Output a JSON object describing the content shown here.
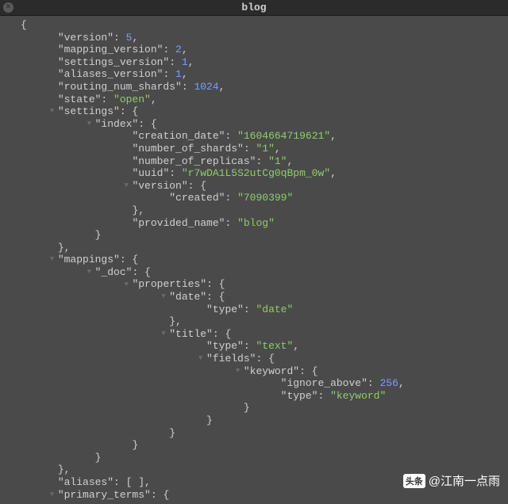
{
  "window": {
    "title": "blog"
  },
  "json_lines": [
    {
      "indent": 0,
      "toggle": "",
      "text": [
        {
          "t": "{",
          "c": "punct"
        }
      ]
    },
    {
      "indent": 2,
      "toggle": "",
      "text": [
        {
          "t": "\"version\"",
          "c": "key"
        },
        {
          "t": ": ",
          "c": "punct"
        },
        {
          "t": "5",
          "c": "num"
        },
        {
          "t": ",",
          "c": "punct"
        }
      ]
    },
    {
      "indent": 2,
      "toggle": "",
      "text": [
        {
          "t": "\"mapping_version\"",
          "c": "key"
        },
        {
          "t": ": ",
          "c": "punct"
        },
        {
          "t": "2",
          "c": "num"
        },
        {
          "t": ",",
          "c": "punct"
        }
      ]
    },
    {
      "indent": 2,
      "toggle": "",
      "text": [
        {
          "t": "\"settings_version\"",
          "c": "key"
        },
        {
          "t": ": ",
          "c": "punct"
        },
        {
          "t": "1",
          "c": "num"
        },
        {
          "t": ",",
          "c": "punct"
        }
      ]
    },
    {
      "indent": 2,
      "toggle": "",
      "text": [
        {
          "t": "\"aliases_version\"",
          "c": "key"
        },
        {
          "t": ": ",
          "c": "punct"
        },
        {
          "t": "1",
          "c": "num"
        },
        {
          "t": ",",
          "c": "punct"
        }
      ]
    },
    {
      "indent": 2,
      "toggle": "",
      "text": [
        {
          "t": "\"routing_num_shards\"",
          "c": "key"
        },
        {
          "t": ": ",
          "c": "punct"
        },
        {
          "t": "1024",
          "c": "num"
        },
        {
          "t": ",",
          "c": "punct"
        }
      ]
    },
    {
      "indent": 2,
      "toggle": "",
      "text": [
        {
          "t": "\"state\"",
          "c": "key"
        },
        {
          "t": ": ",
          "c": "punct"
        },
        {
          "t": "\"open\"",
          "c": "str"
        },
        {
          "t": ",",
          "c": "punct"
        }
      ]
    },
    {
      "indent": 2,
      "toggle": "▼",
      "text": [
        {
          "t": "\"settings\"",
          "c": "key"
        },
        {
          "t": ": {",
          "c": "punct"
        }
      ]
    },
    {
      "indent": 4,
      "toggle": "▼",
      "text": [
        {
          "t": "\"index\"",
          "c": "key"
        },
        {
          "t": ": {",
          "c": "punct"
        }
      ]
    },
    {
      "indent": 6,
      "toggle": "",
      "text": [
        {
          "t": "\"creation_date\"",
          "c": "key"
        },
        {
          "t": ": ",
          "c": "punct"
        },
        {
          "t": "\"1604664719621\"",
          "c": "str"
        },
        {
          "t": ",",
          "c": "punct"
        }
      ]
    },
    {
      "indent": 6,
      "toggle": "",
      "text": [
        {
          "t": "\"number_of_shards\"",
          "c": "key"
        },
        {
          "t": ": ",
          "c": "punct"
        },
        {
          "t": "\"1\"",
          "c": "str"
        },
        {
          "t": ",",
          "c": "punct"
        }
      ]
    },
    {
      "indent": 6,
      "toggle": "",
      "text": [
        {
          "t": "\"number_of_replicas\"",
          "c": "key"
        },
        {
          "t": ": ",
          "c": "punct"
        },
        {
          "t": "\"1\"",
          "c": "str"
        },
        {
          "t": ",",
          "c": "punct"
        }
      ]
    },
    {
      "indent": 6,
      "toggle": "",
      "text": [
        {
          "t": "\"uuid\"",
          "c": "key"
        },
        {
          "t": ": ",
          "c": "punct"
        },
        {
          "t": "\"r7wDA1L5S2utCg0qBpm_0w\"",
          "c": "str"
        },
        {
          "t": ",",
          "c": "punct"
        }
      ]
    },
    {
      "indent": 6,
      "toggle": "▼",
      "text": [
        {
          "t": "\"version\"",
          "c": "key"
        },
        {
          "t": ": {",
          "c": "punct"
        }
      ]
    },
    {
      "indent": 8,
      "toggle": "",
      "text": [
        {
          "t": "\"created\"",
          "c": "key"
        },
        {
          "t": ": ",
          "c": "punct"
        },
        {
          "t": "\"7090399\"",
          "c": "str"
        }
      ]
    },
    {
      "indent": 6,
      "toggle": "",
      "text": [
        {
          "t": "},",
          "c": "punct"
        }
      ]
    },
    {
      "indent": 6,
      "toggle": "",
      "text": [
        {
          "t": "\"provided_name\"",
          "c": "key"
        },
        {
          "t": ": ",
          "c": "punct"
        },
        {
          "t": "\"blog\"",
          "c": "str"
        }
      ]
    },
    {
      "indent": 4,
      "toggle": "",
      "text": [
        {
          "t": "}",
          "c": "punct"
        }
      ]
    },
    {
      "indent": 2,
      "toggle": "",
      "text": [
        {
          "t": "},",
          "c": "punct"
        }
      ]
    },
    {
      "indent": 2,
      "toggle": "▼",
      "text": [
        {
          "t": "\"mappings\"",
          "c": "key"
        },
        {
          "t": ": {",
          "c": "punct"
        }
      ]
    },
    {
      "indent": 4,
      "toggle": "▼",
      "text": [
        {
          "t": "\"_doc\"",
          "c": "key"
        },
        {
          "t": ": {",
          "c": "punct"
        }
      ]
    },
    {
      "indent": 6,
      "toggle": "▼",
      "text": [
        {
          "t": "\"properties\"",
          "c": "key"
        },
        {
          "t": ": {",
          "c": "punct"
        }
      ]
    },
    {
      "indent": 8,
      "toggle": "▼",
      "text": [
        {
          "t": "\"date\"",
          "c": "key"
        },
        {
          "t": ": {",
          "c": "punct"
        }
      ]
    },
    {
      "indent": 10,
      "toggle": "",
      "text": [
        {
          "t": "\"type\"",
          "c": "key"
        },
        {
          "t": ": ",
          "c": "punct"
        },
        {
          "t": "\"date\"",
          "c": "str"
        }
      ]
    },
    {
      "indent": 8,
      "toggle": "",
      "text": [
        {
          "t": "},",
          "c": "punct"
        }
      ]
    },
    {
      "indent": 8,
      "toggle": "▼",
      "text": [
        {
          "t": "\"title\"",
          "c": "key"
        },
        {
          "t": ": {",
          "c": "punct"
        }
      ]
    },
    {
      "indent": 10,
      "toggle": "",
      "text": [
        {
          "t": "\"type\"",
          "c": "key"
        },
        {
          "t": ": ",
          "c": "punct"
        },
        {
          "t": "\"text\"",
          "c": "str"
        },
        {
          "t": ",",
          "c": "punct"
        }
      ]
    },
    {
      "indent": 10,
      "toggle": "▼",
      "text": [
        {
          "t": "\"fields\"",
          "c": "key"
        },
        {
          "t": ": {",
          "c": "punct"
        }
      ]
    },
    {
      "indent": 12,
      "toggle": "▼",
      "text": [
        {
          "t": "\"keyword\"",
          "c": "key"
        },
        {
          "t": ": {",
          "c": "punct"
        }
      ]
    },
    {
      "indent": 14,
      "toggle": "",
      "text": [
        {
          "t": "\"ignore_above\"",
          "c": "key"
        },
        {
          "t": ": ",
          "c": "punct"
        },
        {
          "t": "256",
          "c": "num"
        },
        {
          "t": ",",
          "c": "punct"
        }
      ]
    },
    {
      "indent": 14,
      "toggle": "",
      "text": [
        {
          "t": "\"type\"",
          "c": "key"
        },
        {
          "t": ": ",
          "c": "punct"
        },
        {
          "t": "\"keyword\"",
          "c": "str"
        }
      ]
    },
    {
      "indent": 12,
      "toggle": "",
      "text": [
        {
          "t": "}",
          "c": "punct"
        }
      ]
    },
    {
      "indent": 10,
      "toggle": "",
      "text": [
        {
          "t": "}",
          "c": "punct"
        }
      ]
    },
    {
      "indent": 8,
      "toggle": "",
      "text": [
        {
          "t": "}",
          "c": "punct"
        }
      ]
    },
    {
      "indent": 6,
      "toggle": "",
      "text": [
        {
          "t": "}",
          "c": "punct"
        }
      ]
    },
    {
      "indent": 4,
      "toggle": "",
      "text": [
        {
          "t": "}",
          "c": "punct"
        }
      ]
    },
    {
      "indent": 2,
      "toggle": "",
      "text": [
        {
          "t": "},",
          "c": "punct"
        }
      ]
    },
    {
      "indent": 2,
      "toggle": "",
      "text": [
        {
          "t": "\"aliases\"",
          "c": "key"
        },
        {
          "t": ": [ ],",
          "c": "punct"
        }
      ]
    },
    {
      "indent": 2,
      "toggle": "▼",
      "text": [
        {
          "t": "\"primary_terms\"",
          "c": "key"
        },
        {
          "t": ": {",
          "c": "punct"
        }
      ]
    }
  ],
  "watermark": {
    "logo": "头条",
    "user": "@江南一点雨"
  }
}
